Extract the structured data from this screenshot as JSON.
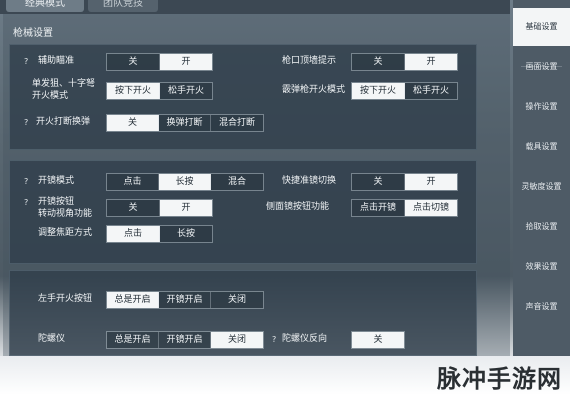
{
  "mode_tabs": {
    "active": "经典模式",
    "inactive": "团队竞技"
  },
  "section_title": "枪械设置",
  "panel1": {
    "aim_assist": {
      "label": "辅助瞄准",
      "options": [
        "关",
        "开"
      ]
    },
    "muzzle_hint": {
      "label": "枪口顶墙提示",
      "options": [
        "关",
        "开"
      ]
    },
    "single_fire": {
      "label_line1": "单发狙、十字弩",
      "label_line2": "开火模式",
      "options": [
        "按下开火",
        "松手开火"
      ]
    },
    "shotgun_fire": {
      "label": "霰弹枪开火模式",
      "options": [
        "按下开火",
        "松手开火"
      ]
    },
    "fire_interrupt": {
      "label": "开火打断换弹",
      "options": [
        "关",
        "换弹打断",
        "混合打断"
      ]
    }
  },
  "panel2": {
    "scope_mode": {
      "label": "开镜模式",
      "options": [
        "点击",
        "长按",
        "混合"
      ]
    },
    "quick_scope_switch": {
      "label": "快捷准镜切换",
      "options": [
        "关",
        "开"
      ]
    },
    "scope_button_rotate": {
      "label_line1": "开镜按钮",
      "label_line2": "转动视角功能",
      "options": [
        "关",
        "开"
      ]
    },
    "side_scope_button": {
      "label": "侧面镜按钮功能",
      "options": [
        "点击开镜",
        "点击切镜"
      ]
    },
    "zoom_mode": {
      "label": "调整焦距方式",
      "options": [
        "点击",
        "长按"
      ]
    }
  },
  "panel3": {
    "left_fire": {
      "label": "左手开火按钮",
      "options": [
        "总是开启",
        "开镜开启",
        "关闭"
      ]
    },
    "gyro": {
      "label": "陀螺仪",
      "options": [
        "总是开启",
        "开镜开启",
        "关闭"
      ]
    },
    "gyro_reverse": {
      "label": "陀螺仪反向",
      "options": [
        "关"
      ]
    }
  },
  "help_glyph": "?",
  "sidebar": {
    "items": [
      "基础设置",
      "画面设置",
      "操作设置",
      "载具设置",
      "灵敏度设置",
      "拾取设置",
      "效果设置",
      "声音设置"
    ],
    "active_index": 0
  },
  "watermark": "脉冲手游网",
  "colors": {
    "selected_bg": "#f4f6f7",
    "panel_bg": "#303e4a",
    "sidebar_bg": "#4e5b66"
  }
}
